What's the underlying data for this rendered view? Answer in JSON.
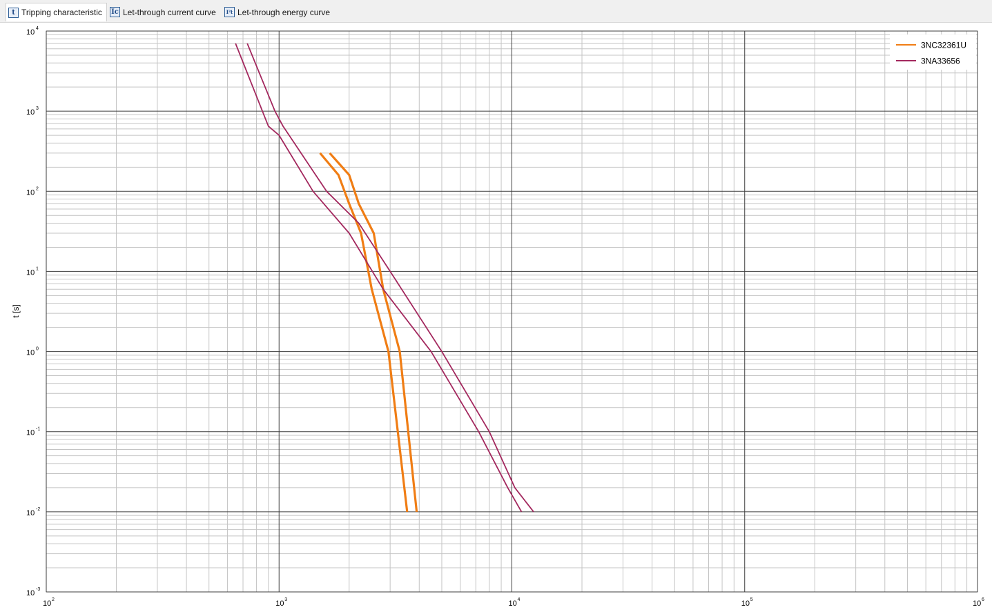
{
  "tabs": [
    {
      "label": "Tripping characteristic",
      "icon": "t",
      "active": true
    },
    {
      "label": "Let-through current curve",
      "icon": "Ic",
      "active": false
    },
    {
      "label": "Let-through energy curve",
      "icon": "I²t",
      "active": false
    }
  ],
  "chart_data": {
    "type": "line",
    "title": "",
    "xlabel": "",
    "ylabel": "t [s]",
    "xscale": "log",
    "yscale": "log",
    "xlim": [
      100,
      1000000
    ],
    "ylim": [
      0.001,
      10000
    ],
    "grid": true,
    "legend_position": "top-right",
    "x_tick_labels": [
      {
        "base": "10",
        "exp": "2"
      },
      {
        "base": "10",
        "exp": "3"
      },
      {
        "base": "10",
        "exp": "4"
      },
      {
        "base": "10",
        "exp": "5"
      },
      {
        "base": "10",
        "exp": "6"
      }
    ],
    "y_tick_labels": [
      {
        "base": "10",
        "exp": "4"
      },
      {
        "base": "10",
        "exp": "3"
      },
      {
        "base": "10",
        "exp": "2"
      },
      {
        "base": "10",
        "exp": "1"
      },
      {
        "base": "10",
        "exp": "0"
      },
      {
        "base": "10",
        "exp": "-1"
      },
      {
        "base": "10",
        "exp": "-2"
      },
      {
        "base": "10",
        "exp": "-3"
      }
    ],
    "series": [
      {
        "name": "3NC32361U",
        "color": "#f07d14",
        "curves": [
          {
            "x": [
              1500,
              1800,
              2000,
              2250,
              2500,
              2950,
              3550
            ],
            "y": [
              300,
              160,
              70,
              30,
              6,
              1,
              0.01
            ]
          },
          {
            "x": [
              1650,
              2000,
              2200,
              2550,
              2800,
              3300,
              3900
            ],
            "y": [
              300,
              160,
              70,
              30,
              6,
              1,
              0.01
            ]
          }
        ]
      },
      {
        "name": "3NA33656",
        "color": "#a3285e",
        "curves": [
          {
            "x": [
              650,
              900,
              1000,
              1400,
              2000,
              2800,
              4500,
              7200,
              9600,
              11000
            ],
            "y": [
              7000,
              650,
              500,
              100,
              30,
              6,
              1,
              0.1,
              0.02,
              0.01
            ]
          },
          {
            "x": [
              730,
              960,
              1040,
              1600,
              2200,
              3000,
              5000,
              8000,
              10300,
              12400
            ],
            "y": [
              7000,
              1000,
              650,
              100,
              40,
              10,
              1,
              0.1,
              0.02,
              0.01
            ]
          }
        ]
      }
    ]
  }
}
